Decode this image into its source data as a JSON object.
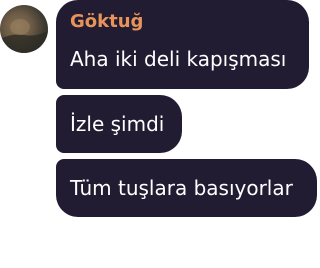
{
  "chat": {
    "sender_name": "Göktuğ",
    "sender_color": "#e8935a",
    "bubble_color": "#221c33",
    "avatar_icon": "user-photo-avatar",
    "messages": [
      {
        "text": "Aha iki deli kapışması"
      },
      {
        "text": "İzle şimdi"
      },
      {
        "text": "Tüm tuşlara basıyorlar"
      }
    ]
  }
}
